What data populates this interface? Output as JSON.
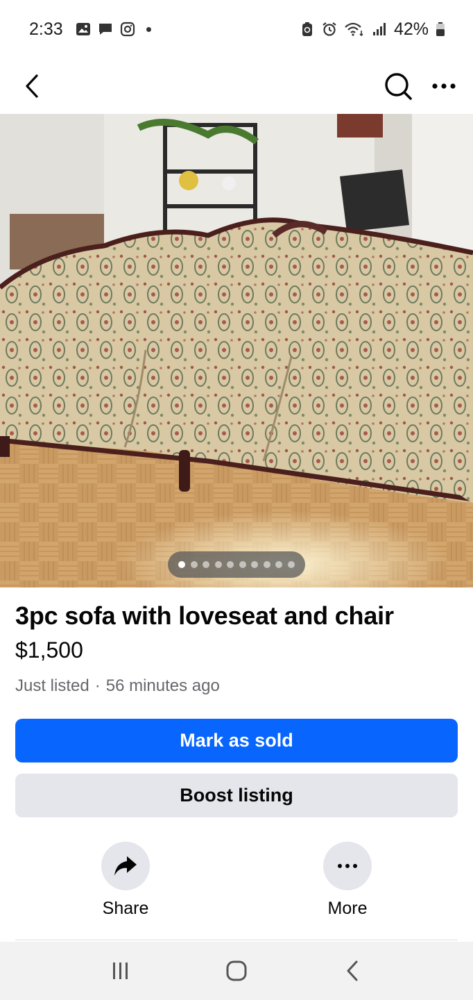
{
  "status_bar": {
    "time": "2:33",
    "battery_percent": "42%",
    "left_icons": [
      "gallery-icon",
      "message-icon",
      "instagram-icon",
      "dot-icon"
    ],
    "right_icons": [
      "battery-saver-icon",
      "alarm-icon",
      "wifi-icon",
      "signal-icon",
      "battery-icon"
    ]
  },
  "top_nav": {
    "back_icon": "back-arrow-icon",
    "search_icon": "search-icon",
    "more_icon": "more-dots-icon"
  },
  "photo": {
    "carousel_count": 10,
    "carousel_active_index": 0
  },
  "listing": {
    "title": "3pc sofa with loveseat and chair",
    "price": "$1,500",
    "status": "Just listed",
    "separator": "·",
    "posted": "56 minutes ago"
  },
  "actions": {
    "mark_sold_label": "Mark as sold",
    "boost_label": "Boost listing",
    "share_label": "Share",
    "more_label": "More"
  },
  "colors": {
    "primary": "#0866ff",
    "secondary_bg": "#e4e6eb",
    "meta_text": "#65676b"
  },
  "android_nav": {
    "recents_icon": "recents-icon",
    "home_icon": "home-icon",
    "back_icon": "android-back-icon"
  }
}
